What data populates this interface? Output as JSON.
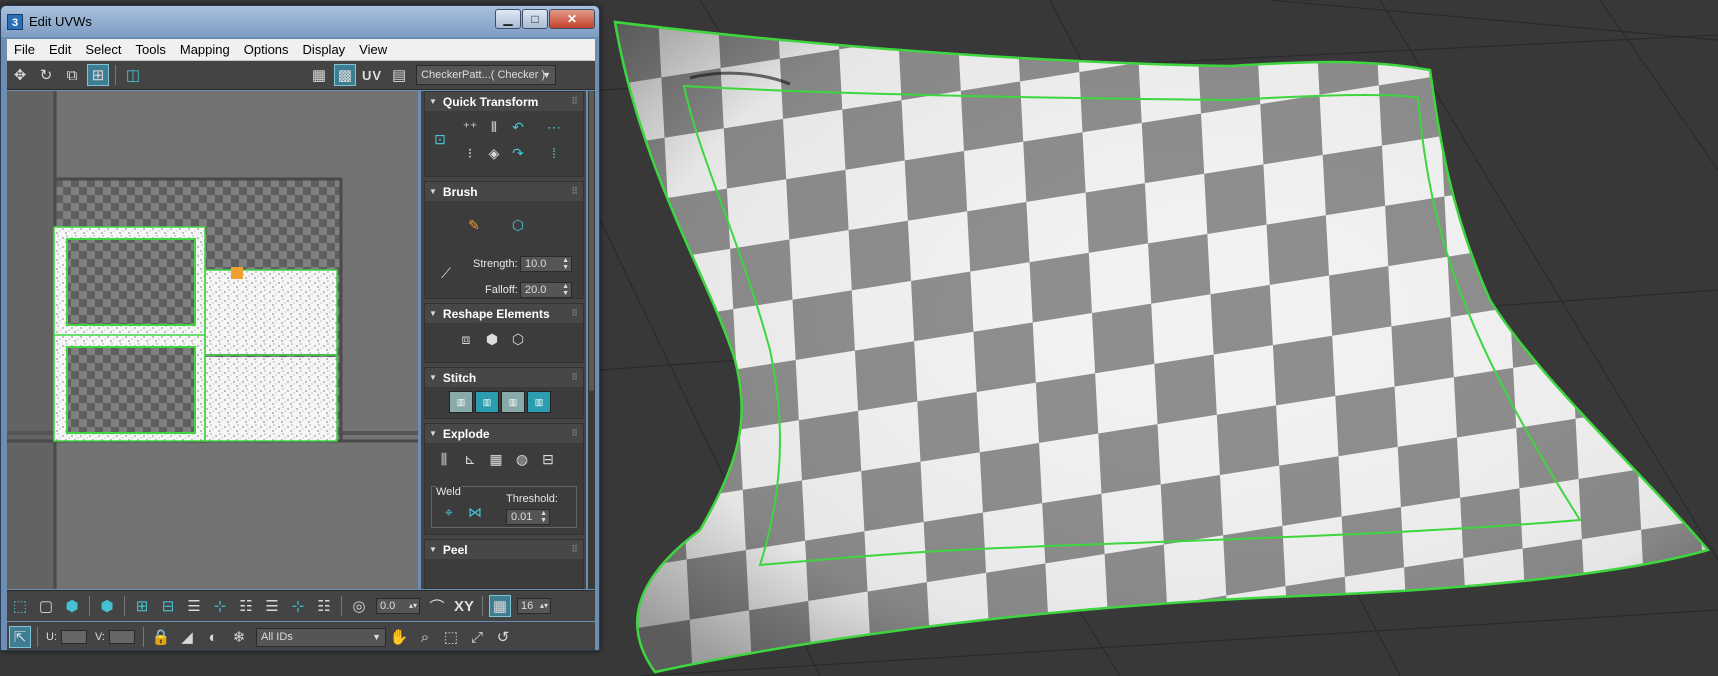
{
  "window": {
    "title": "Edit UVWs",
    "app_icon": "3",
    "buttons": {
      "minimize": "▁",
      "maximize": "□",
      "close": "✕"
    }
  },
  "menubar": [
    "File",
    "Edit",
    "Select",
    "Tools",
    "Mapping",
    "Options",
    "Display",
    "View"
  ],
  "toolbar_top": {
    "icons": [
      "move-icon",
      "rotate-icon",
      "scale-icon",
      "freeform-icon",
      "mirror-icon",
      "show-map-icon",
      "checker-toggle-icon",
      "texture-icon"
    ],
    "uv_label": "UV",
    "texture_dropdown": "CheckerPatt...( Checker )"
  },
  "panel": {
    "quick_transform": {
      "title": "Quick Transform"
    },
    "brush": {
      "title": "Brush",
      "strength_label": "Strength:",
      "strength_value": "10.0",
      "falloff_label": "Falloff:",
      "falloff_value": "20.0"
    },
    "reshape": {
      "title": "Reshape Elements"
    },
    "stitch": {
      "title": "Stitch"
    },
    "explode": {
      "title": "Explode",
      "weld_label": "Weld",
      "threshold_label": "Threshold:",
      "threshold_value": "0.01"
    },
    "peel": {
      "title": "Peel"
    }
  },
  "bottom_toolbar_1": {
    "soft_value": "0.0",
    "xy_label": "XY",
    "grid_value": "16"
  },
  "bottom_toolbar_2": {
    "u_label": "U:",
    "v_label": "V:",
    "ids_dropdown": "All IDs"
  },
  "colors": {
    "selection_green": "#3ed63e",
    "accent_teal": "#46c0d2",
    "viewport_bg": "#383838",
    "checker_dark": "#8c8c8c",
    "checker_light": "#f2f2f2"
  }
}
